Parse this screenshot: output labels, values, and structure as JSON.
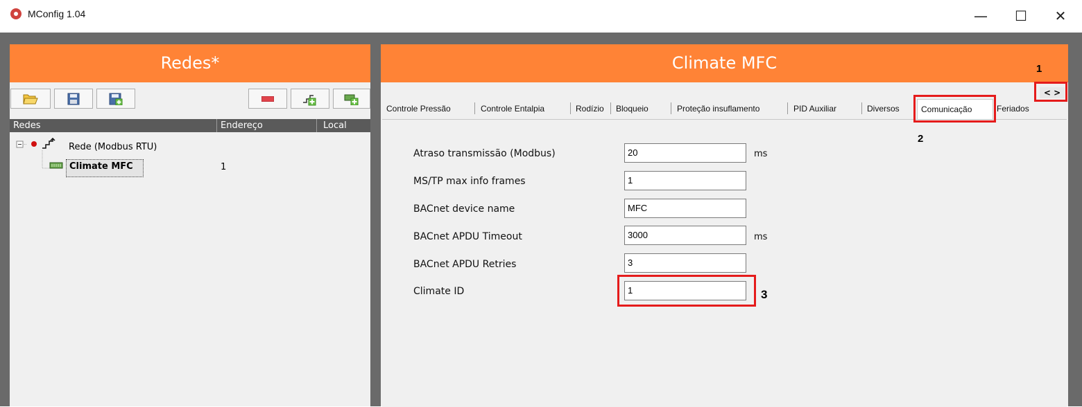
{
  "window": {
    "title": "MConfig 1.04",
    "minimize": "—",
    "maximize": "☐",
    "close": "✕"
  },
  "left_panel": {
    "title": "Redes*",
    "columns": [
      "Redes",
      "Endereço",
      "Local"
    ],
    "tree": {
      "network": "Rede (Modbus RTU)",
      "device": "Climate MFC",
      "device_address": "1"
    }
  },
  "right_panel": {
    "title": "Climate MFC",
    "tabs": [
      "Controle Pressão",
      "Controle Entalpia",
      "Rodízio",
      "Bloqueio",
      "Proteção insuflamento",
      "PID Auxiliar",
      "Diversos",
      "Comunicação",
      "Feriados"
    ],
    "active_tab": "Comunicação",
    "tab_scroll": "< >",
    "fields": [
      {
        "label": "Atraso transmissão (Modbus)",
        "value": "20",
        "unit": "ms"
      },
      {
        "label": "MS/TP max info frames",
        "value": "1",
        "unit": ""
      },
      {
        "label": "BACnet device name",
        "value": "MFC",
        "unit": ""
      },
      {
        "label": "BACnet APDU Timeout",
        "value": "3000",
        "unit": "ms"
      },
      {
        "label": "BACnet APDU Retries",
        "value": "3",
        "unit": ""
      },
      {
        "label": "Climate ID",
        "value": "1",
        "unit": ""
      }
    ]
  },
  "annotations": [
    "1",
    "2",
    "3"
  ],
  "colors": {
    "header_orange": "#ff8336",
    "annotation_red": "#e51b1b",
    "background_gray": "#6a6a6a"
  }
}
